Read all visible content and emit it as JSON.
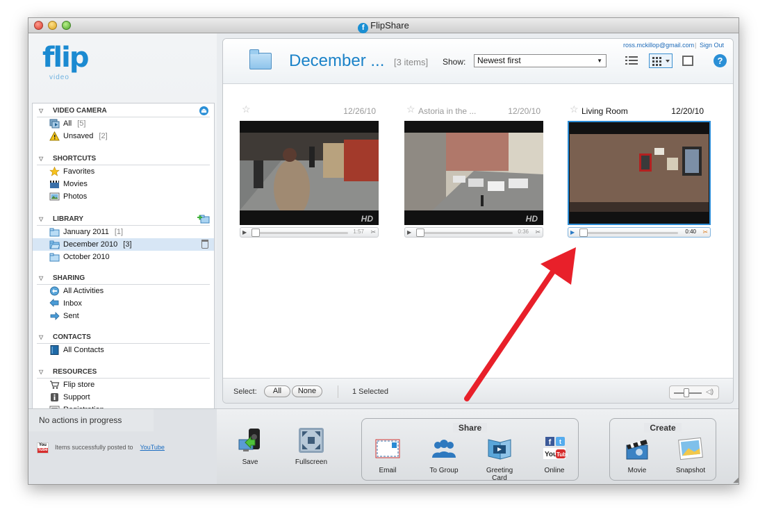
{
  "window": {
    "title": "FlipShare"
  },
  "brand": {
    "name": "flip",
    "sub": "video"
  },
  "sidebar": {
    "video_camera": {
      "title": "VIDEO CAMERA",
      "items": [
        {
          "label": "All",
          "count": "[5]"
        },
        {
          "label": "Unsaved",
          "count": "[2]"
        }
      ]
    },
    "shortcuts": {
      "title": "SHORTCUTS",
      "items": [
        {
          "label": "Favorites"
        },
        {
          "label": "Movies"
        },
        {
          "label": "Photos"
        }
      ]
    },
    "library": {
      "title": "LIBRARY",
      "items": [
        {
          "label": "January 2011",
          "count": "[1]"
        },
        {
          "label": "December 2010",
          "count": "[3]"
        },
        {
          "label": "October 2010"
        }
      ]
    },
    "sharing": {
      "title": "SHARING",
      "items": [
        {
          "label": "All Activities"
        },
        {
          "label": "Inbox"
        },
        {
          "label": "Sent"
        }
      ]
    },
    "contacts": {
      "title": "CONTACTS",
      "items": [
        {
          "label": "All Contacts"
        }
      ]
    },
    "resources": {
      "title": "RESOURCES",
      "items": [
        {
          "label": "Flip store"
        },
        {
          "label": "Support"
        },
        {
          "label": "Registration"
        }
      ]
    }
  },
  "status": {
    "progress": "No actions in progress",
    "posted_text": "Items successfully posted to",
    "posted_link": "YouTube",
    "badge_top": "You",
    "badge_bottom": "Tube"
  },
  "header": {
    "title": "December ...",
    "items": "[3 items]",
    "show_label": "Show:",
    "show_value": "Newest first",
    "user_email": "ross.mckillop@gmail.com",
    "separator": "|",
    "sign_out": "Sign Out",
    "help": "?"
  },
  "videos": [
    {
      "name": "",
      "date": "12/26/10",
      "duration": "1:57",
      "hd": "HD"
    },
    {
      "name": "Astoria in the ...",
      "date": "12/20/10",
      "duration": "0:36",
      "hd": "HD"
    },
    {
      "name": "Living Room",
      "date": "12/20/10",
      "duration": "0:40",
      "hd": ""
    }
  ],
  "footer": {
    "select_label": "Select:",
    "all": "All",
    "none": "None",
    "selected": "1 Selected"
  },
  "toolbar": {
    "save": "Save",
    "fullscreen": "Fullscreen",
    "share_title": "Share",
    "email": "Email",
    "to_group": "To Group",
    "greeting_1": "Greeting",
    "greeting_2": "Card",
    "online": "Online",
    "create_title": "Create",
    "movie": "Movie",
    "snapshot": "Snapshot"
  },
  "colors": {
    "accent": "#1b82c8",
    "arrow": "#e8202a",
    "selection": "#2b8bd4"
  }
}
